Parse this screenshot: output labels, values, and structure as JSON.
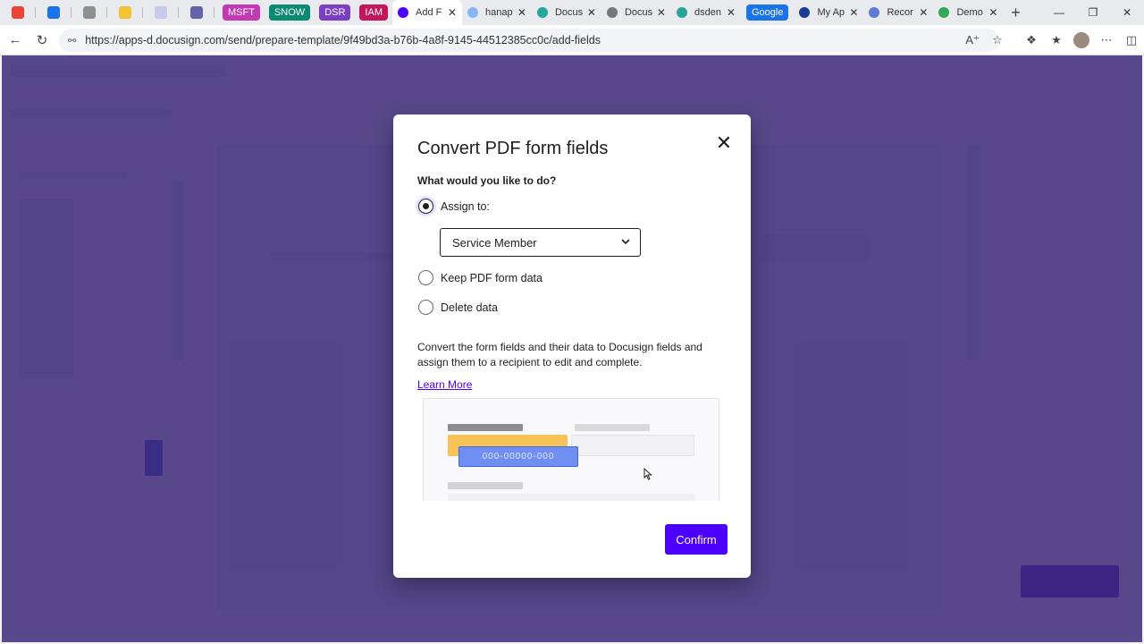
{
  "browser": {
    "pinned_tabs": [
      {
        "icon": "gmail-icon",
        "color": "#ea4335"
      },
      {
        "icon": "calendar-icon",
        "color": "#1a73e8"
      },
      {
        "icon": "app-icon",
        "color": "#8f8f8f"
      },
      {
        "icon": "notes-icon",
        "color": "#f1c232"
      },
      {
        "icon": "arrow-icon",
        "color": "#c5cbe9"
      },
      {
        "icon": "teams-icon",
        "color": "#6264a7"
      }
    ],
    "chips": [
      {
        "label": "MSFT",
        "color": "#c239b3"
      },
      {
        "label": "SNOW",
        "color": "#0a8a73"
      },
      {
        "label": "DSR",
        "color": "#7b3fc4"
      },
      {
        "label": "IAM",
        "color": "#c2185b"
      }
    ],
    "tabs": [
      {
        "label": "Add F",
        "active": true,
        "icon_color": "#4c00ff"
      },
      {
        "label": "hanap",
        "active": false,
        "icon_color": "#8ab4f8"
      },
      {
        "label": "Docus",
        "active": false,
        "icon_color": "#26a69a"
      },
      {
        "label": "Docus",
        "active": false,
        "icon_color": "#777777"
      },
      {
        "label": "dsden",
        "active": false,
        "icon_color": "#26a69a"
      }
    ],
    "google_chip": "Google",
    "tabs2": [
      {
        "label": "My Ap",
        "icon_color": "#1a3d8f"
      },
      {
        "label": "Recor",
        "icon_color": "#5b7bd5"
      },
      {
        "label": "Demo",
        "icon_color": "#34a853"
      }
    ],
    "url": "https://apps-d.docusign.com/send/prepare-template/9f49bd3a-b76b-4a8f-9145-44512385cc0c/add-fields"
  },
  "modal": {
    "title": "Convert PDF form fields",
    "question": "What would you like to do?",
    "options": [
      {
        "label": "Assign to:",
        "checked": true
      },
      {
        "label": "Keep PDF form data",
        "checked": false
      },
      {
        "label": "Delete data",
        "checked": false
      }
    ],
    "assignee_select": "Service Member",
    "description": "Convert the form fields and their data to Docusign fields and assign them to a recipient to edit and complete.",
    "learn_more": "Learn More",
    "illustration_field_text": "000-00000-000",
    "confirm_label": "Confirm"
  },
  "colors": {
    "accent": "#4c00ff",
    "overlay": "#2e1a6e"
  }
}
